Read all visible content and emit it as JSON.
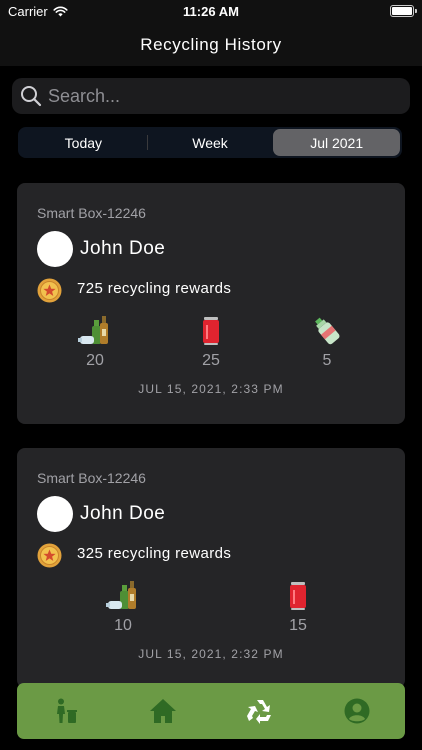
{
  "status_bar": {
    "carrier": "Carrier",
    "time": "11:26 AM"
  },
  "nav": {
    "title": "Recycling History"
  },
  "search": {
    "placeholder": "Search..."
  },
  "segments": [
    {
      "label": "Today",
      "selected": false
    },
    {
      "label": "Week",
      "selected": false
    },
    {
      "label": "Jul 2021",
      "selected": true
    }
  ],
  "history": [
    {
      "box_id": "Smart Box-12246",
      "user_name": "John Doe",
      "rewards": "725 recycling rewards",
      "items": [
        {
          "icon": "glass-bottles-icon",
          "count": "20"
        },
        {
          "icon": "can-icon",
          "count": "25"
        },
        {
          "icon": "plastic-bottle-icon",
          "count": "5"
        }
      ],
      "timestamp": "JUL 15, 2021, 2:33 PM"
    },
    {
      "box_id": "Smart Box-12246",
      "user_name": "John Doe",
      "rewards": "325 recycling rewards",
      "items": [
        {
          "icon": "glass-bottles-icon",
          "count": "10"
        },
        {
          "icon": "can-icon",
          "count": "15"
        }
      ],
      "timestamp": "JUL 15, 2021, 2:32 PM"
    }
  ],
  "tabs": [
    {
      "icon": "person-trash-icon",
      "selected": false
    },
    {
      "icon": "home-icon",
      "selected": false
    },
    {
      "icon": "recycle-icon",
      "selected": true
    },
    {
      "icon": "profile-icon",
      "selected": false
    }
  ],
  "colors": {
    "background": "#000000",
    "card": "#252527",
    "tab_bar": "#6b9a45",
    "tab_icon": "#2f6a24",
    "tab_icon_selected": "#ffffff"
  }
}
